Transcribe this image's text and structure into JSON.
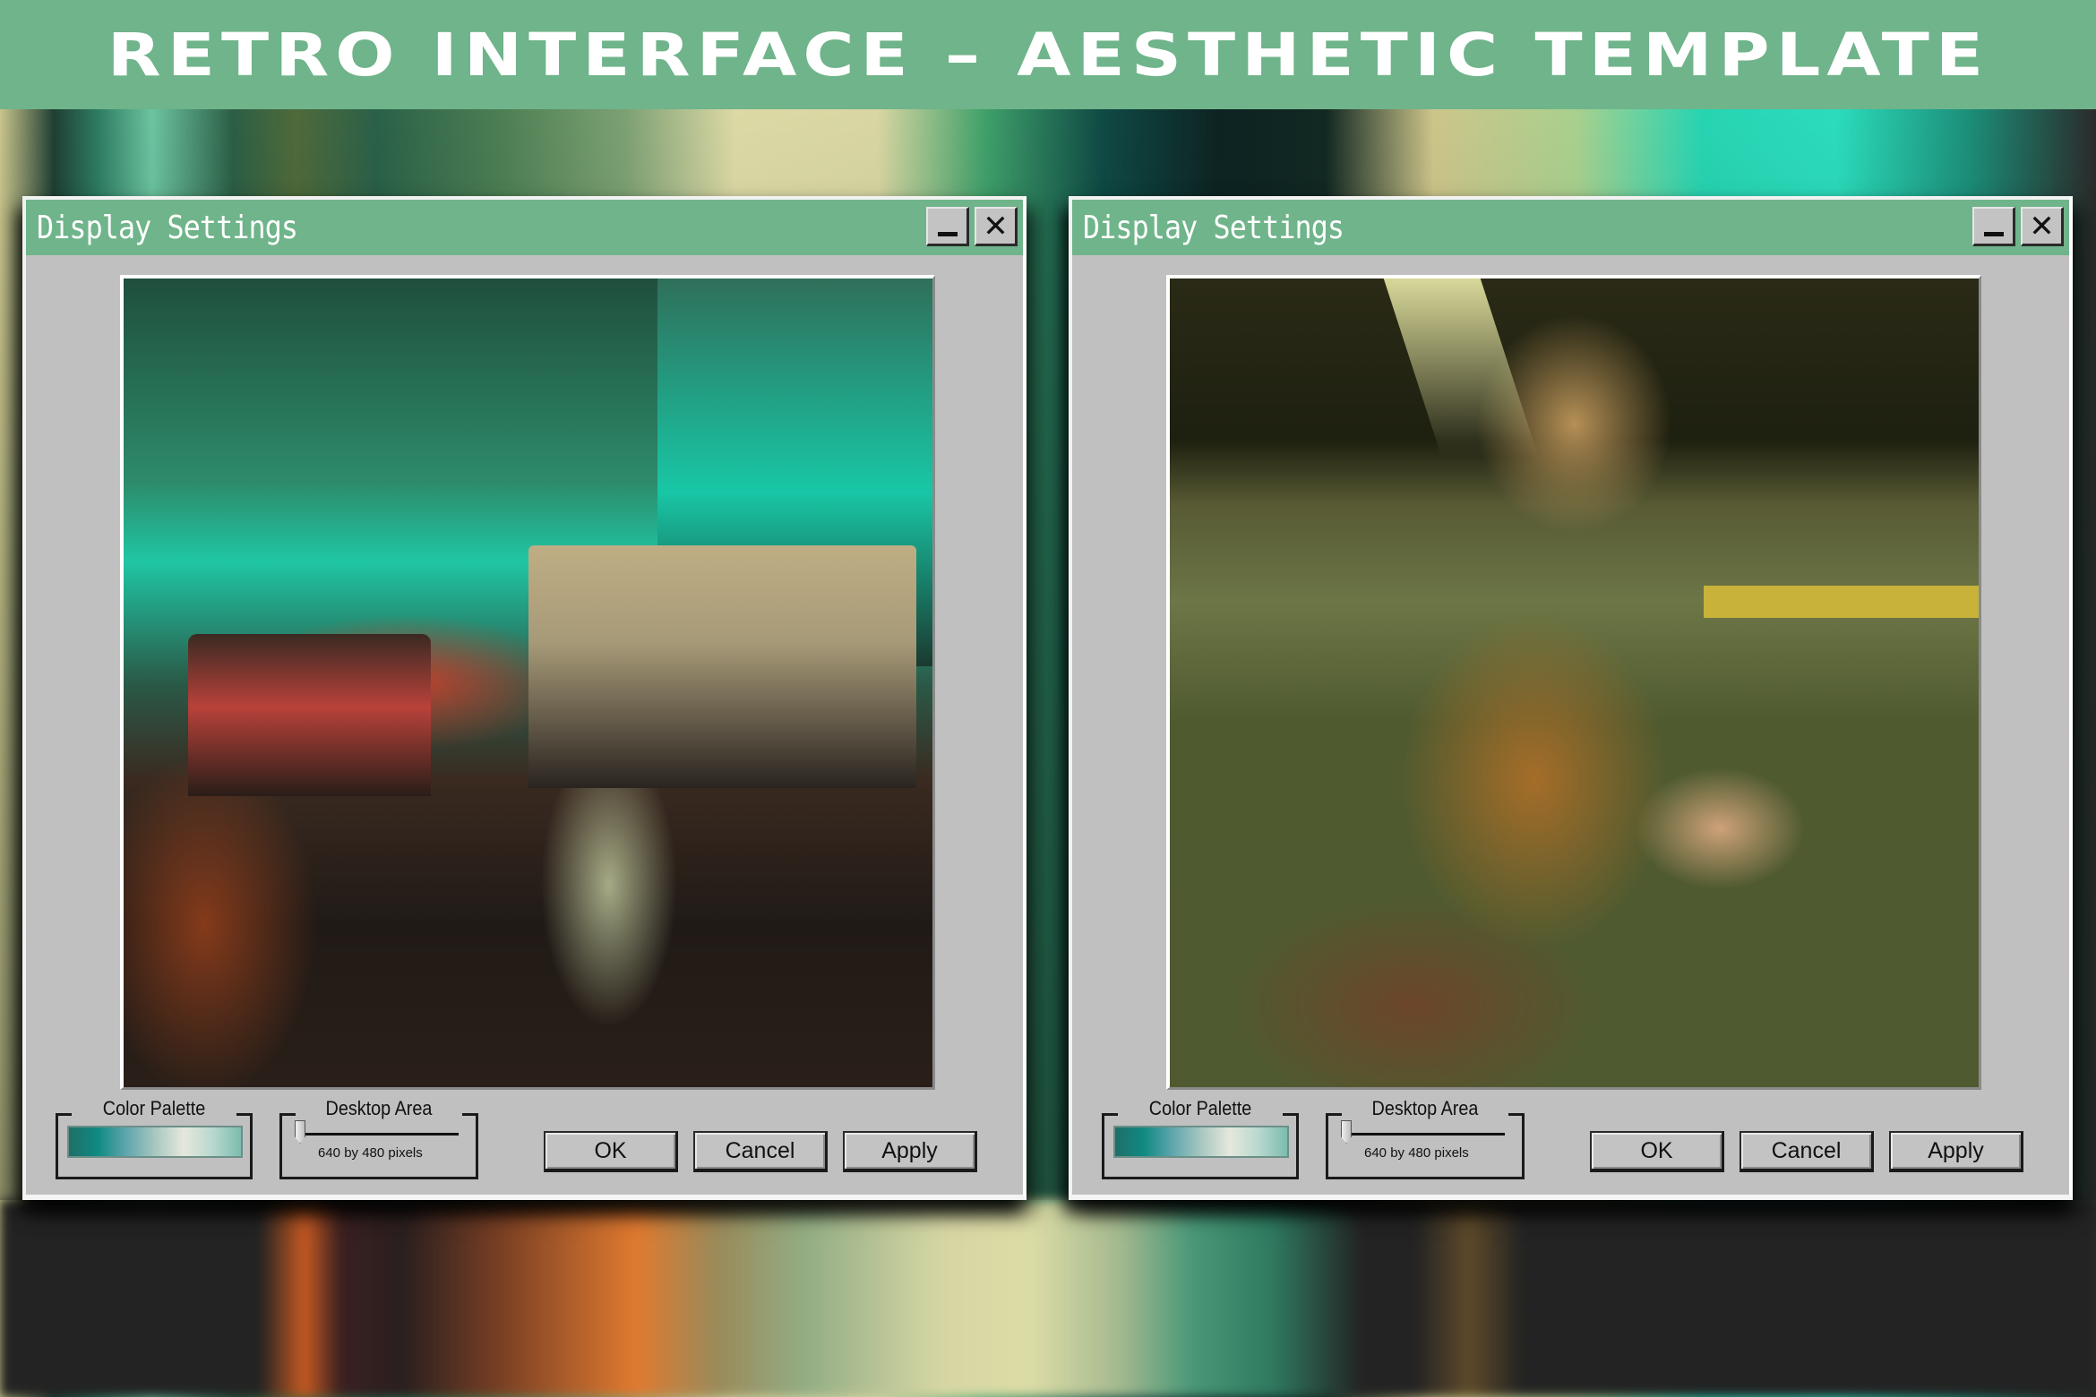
{
  "header": {
    "title": "RETRO INTERFACE – AESTHETIC TEMPLATE",
    "background_color": "#6fb48a"
  },
  "windows": [
    {
      "title": "Display Settings",
      "titlebar_color": "#6fb48a",
      "minimize_icon": "minimize-icon",
      "close_icon": "close-icon",
      "minimize_glyph": "",
      "close_glyph": "✕",
      "photo_description": "Pixelated rainy city street at night with cars, red tail lights and teal-lit buildings",
      "color_palette": {
        "label": "Color Palette",
        "colors": [
          "#1f6f68",
          "#0f8a82",
          "#5fa6ae",
          "#a7c7c0",
          "#e6e8dc",
          "#b9d8cf",
          "#7cbcae"
        ]
      },
      "desktop_area": {
        "label": "Desktop Area",
        "value_text": "640 by 480 pixels",
        "slider_position": 0
      },
      "buttons": {
        "ok": "OK",
        "cancel": "Cancel",
        "apply": "Apply"
      }
    },
    {
      "title": "Display Settings",
      "titlebar_color": "#6fb48a",
      "minimize_icon": "minimize-icon",
      "close_icon": "close-icon",
      "minimize_glyph": "",
      "close_glyph": "✕",
      "photo_description": "Pixelated photo of a woman crouching in a dim parking garage wearing a fur coat",
      "color_palette": {
        "label": "Color Palette",
        "colors": [
          "#1f6f68",
          "#0f8a82",
          "#5fa6ae",
          "#a7c7c0",
          "#e6e8dc",
          "#b9d8cf",
          "#7cbcae"
        ]
      },
      "desktop_area": {
        "label": "Desktop Area",
        "value_text": "640 by 480 pixels",
        "slider_position": 0
      },
      "buttons": {
        "ok": "OK",
        "cancel": "Cancel",
        "apply": "Apply"
      }
    }
  ]
}
